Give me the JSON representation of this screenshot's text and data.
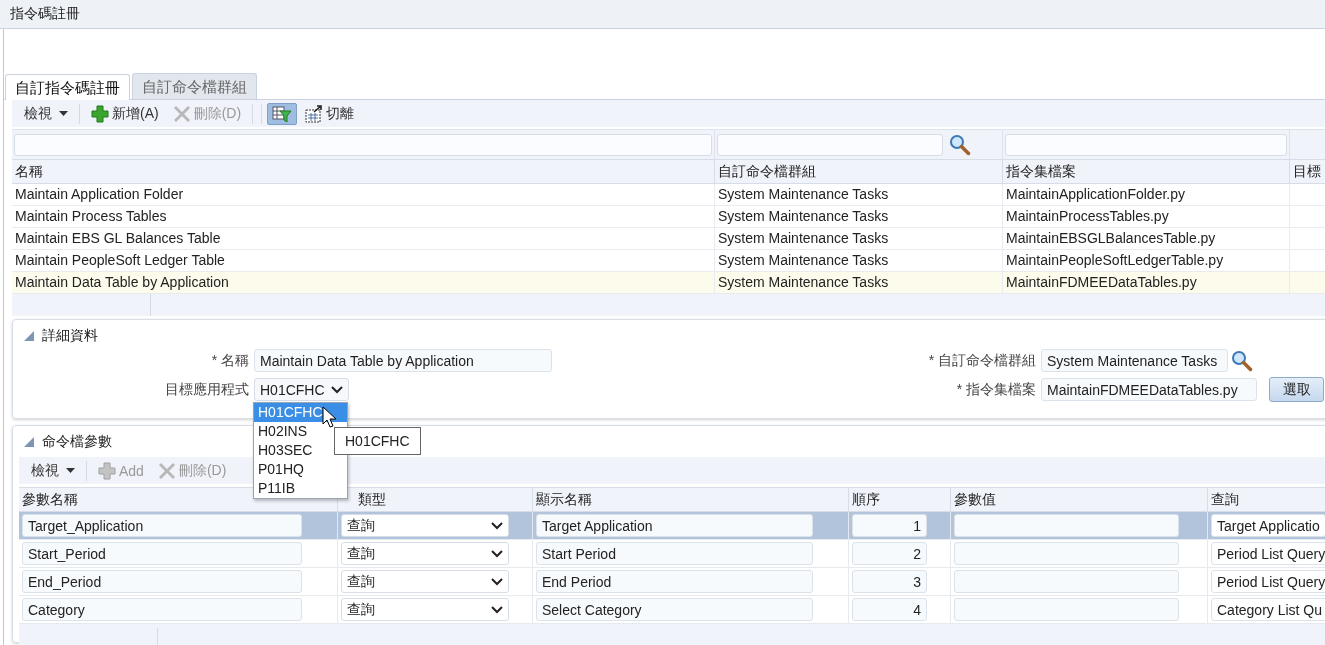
{
  "window": {
    "title": "指令碼註冊"
  },
  "tabs": [
    {
      "label": "自訂指令碼註冊",
      "selected": true
    },
    {
      "label": "自訂命令檔群組",
      "selected": false
    }
  ],
  "toolbar": [
    {
      "kind": "menu",
      "label": "檢視"
    },
    {
      "kind": "add",
      "label": "新增(A)",
      "disabled": false
    },
    {
      "kind": "delete",
      "label": "刪除(D)",
      "disabled": true
    },
    {
      "kind": "filter",
      "on": true
    },
    {
      "kind": "detach",
      "label": "切離"
    }
  ],
  "scripts_table": {
    "columns": [
      "名稱",
      "自訂命令檔群組",
      "指令集檔案",
      "目標"
    ],
    "rows": [
      {
        "cells": [
          "Maintain Application Folder",
          "System Maintenance Tasks",
          "MaintainApplicationFolder.py"
        ],
        "selected": false
      },
      {
        "cells": [
          "Maintain Process Tables",
          "System Maintenance Tasks",
          "MaintainProcessTables.py"
        ],
        "selected": false
      },
      {
        "cells": [
          "Maintain EBS GL Balances Table",
          "System Maintenance Tasks",
          "MaintainEBSGLBalancesTable.py"
        ],
        "selected": false
      },
      {
        "cells": [
          "Maintain PeopleSoft Ledger Table",
          "System Maintenance Tasks",
          "MaintainPeopleSoftLedgerTable.py"
        ],
        "selected": false
      },
      {
        "cells": [
          "Maintain Data Table by Application",
          "System Maintenance Tasks",
          "MaintainFDMEEDataTables.py"
        ],
        "selected": true
      }
    ]
  },
  "details": {
    "title": "詳細資料",
    "expanded": true,
    "name": {
      "label": "* 名稱",
      "value": "Maintain Data Table by Application"
    },
    "target_application": {
      "label": "目標應用程式",
      "value": "H01CFHC",
      "options": [
        {
          "label": "H01CFHC",
          "selected": true
        },
        {
          "label": "H02INS",
          "selected": false
        },
        {
          "label": "H03SEC",
          "selected": false
        },
        {
          "label": "P01HQ",
          "selected": false
        },
        {
          "label": "P11IB",
          "selected": false
        }
      ],
      "tooltip": "H01CFHC"
    },
    "group": {
      "label": "* 自訂命令檔群組",
      "value": "System Maintenance Tasks"
    },
    "script_file": {
      "label": "* 指令集檔案",
      "value": "MaintainFDMEEDataTables.py"
    },
    "select_button": "選取"
  },
  "parameters": {
    "title": "命令檔參數",
    "expanded": true,
    "toolbar": [
      {
        "kind": "menu",
        "label": "檢視"
      },
      {
        "kind": "add",
        "label": "Add",
        "disabled": true
      },
      {
        "kind": "delete",
        "label": "刪除(D)",
        "disabled": true
      }
    ],
    "columns": [
      "參數名稱",
      "類型",
      "顯示名稱",
      "順序",
      "參數值",
      "查詢"
    ],
    "rows": [
      {
        "name": "Target_Application",
        "type": "查詢",
        "display_name": "Target Application",
        "order": "1",
        "query": "Target Applicatio",
        "selected": true
      },
      {
        "name": "Start_Period",
        "type": "查詢",
        "display_name": "Start Period",
        "order": "2",
        "query": "Period List Query",
        "selected": false
      },
      {
        "name": "End_Period",
        "type": "查詢",
        "display_name": "End Period",
        "order": "3",
        "query": "Period List Query",
        "selected": false
      },
      {
        "name": "Category",
        "type": "查詢",
        "display_name": "Select Category",
        "order": "4",
        "query": "Category List Qu",
        "selected": false
      }
    ]
  }
}
